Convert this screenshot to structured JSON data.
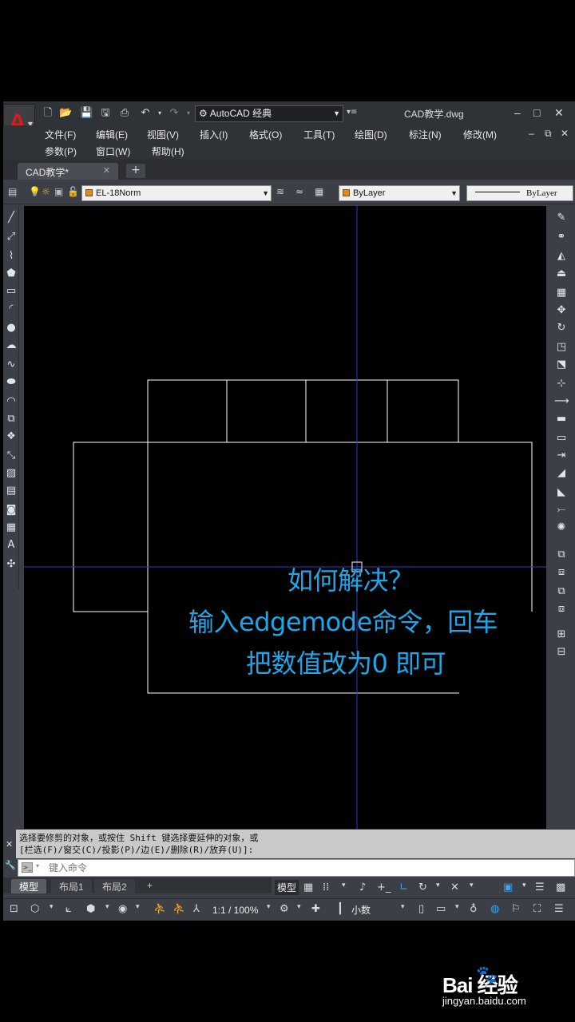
{
  "title_bar": {
    "workspace": "AutoCAD 经典",
    "document_title": "CAD教学.dwg"
  },
  "menus": {
    "file": "文件(F)",
    "edit": "编辑(E)",
    "view": "视图(V)",
    "insert": "插入(I)",
    "format": "格式(O)",
    "tools": "工具(T)",
    "draw": "绘图(D)",
    "dimension": "标注(N)",
    "modify": "修改(M)",
    "params": "参数(P)",
    "window": "窗口(W)",
    "help": "帮助(H)"
  },
  "file_tab": {
    "label": "CAD教学*",
    "new_tab": "+"
  },
  "properties": {
    "layer": "EL-18Norm",
    "color": "ByLayer",
    "linetype": "ByLayer"
  },
  "annotation": {
    "line1": "如何解决？",
    "line2": "输入edgemode命令，回车",
    "line3": "把数值改为0 即可"
  },
  "command": {
    "history_line1": "选择要修剪的对象，或按住 Shift 键选择要延伸的对象，或",
    "history_line2": "[栏选(F)/窗交(C)/投影(P)/边(E)/删除(R)/放弃(U)]:",
    "placeholder": "键入命令"
  },
  "layout_tabs": [
    "模型",
    "布局1",
    "布局2",
    "+"
  ],
  "status": {
    "model": "模型",
    "scale": "1:1 / 100%",
    "units": "小数"
  },
  "watermark": {
    "logo": "Bai  经验",
    "url": "jingyan.baidu.com"
  },
  "colors": {
    "annotation": "#1ea6e8",
    "crosshair": "#2a3cc8",
    "geometry": "#ffffff",
    "app_logo": "#d01f1f"
  }
}
